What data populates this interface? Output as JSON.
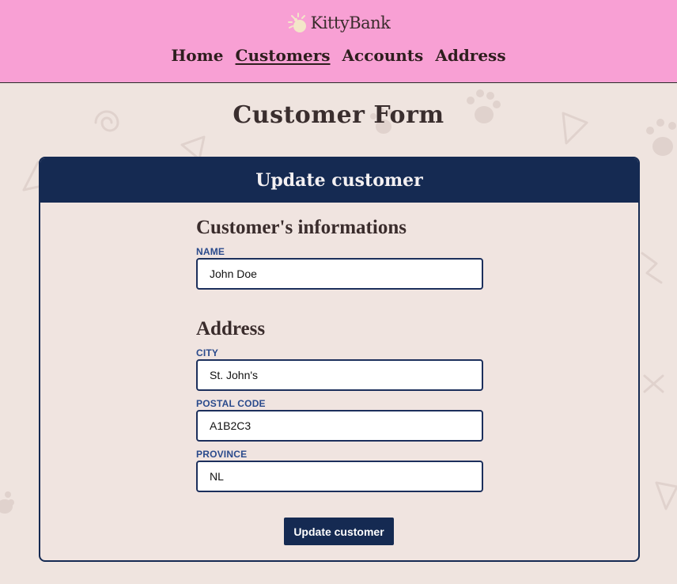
{
  "header": {
    "brand_name": "KittyBank",
    "nav": [
      {
        "label": "Home",
        "active": false
      },
      {
        "label": "Customers",
        "active": true
      },
      {
        "label": "Accounts",
        "active": false
      },
      {
        "label": "Address",
        "active": false
      }
    ]
  },
  "page": {
    "title": "Customer Form"
  },
  "card": {
    "header": "Update customer",
    "info_section": {
      "title": "Customer's informations",
      "name_label": "NAME",
      "name_value": "John Doe"
    },
    "address_section": {
      "title": "Address",
      "city_label": "CITY",
      "city_value": "St. John's",
      "postal_label": "POSTAL CODE",
      "postal_value": "A1B2C3",
      "province_label": "PROVINCE",
      "province_value": "NL"
    },
    "submit_label": "Update customer"
  },
  "colors": {
    "header_bg": "#f8a0d4",
    "page_bg": "#efe4df",
    "navy": "#152a52",
    "label_blue": "#2a4a8c"
  }
}
